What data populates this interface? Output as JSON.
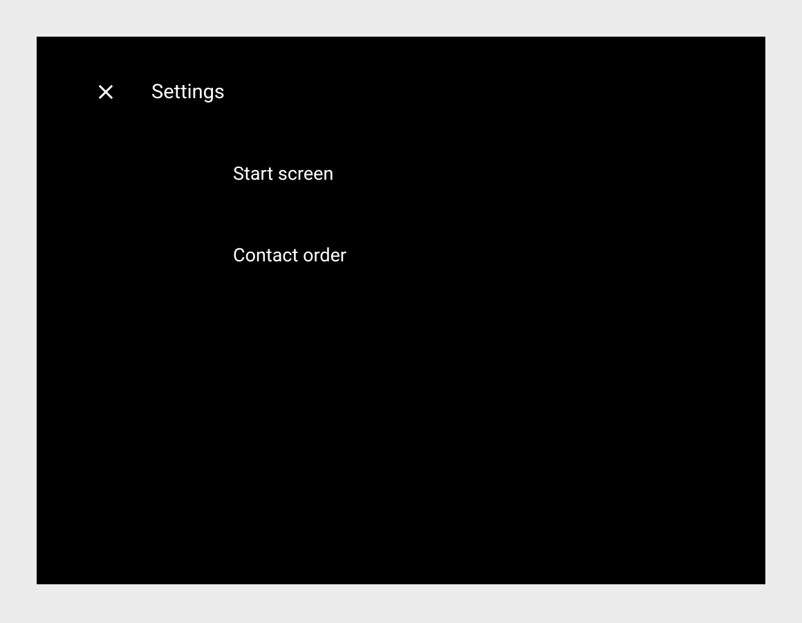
{
  "header": {
    "title": "Settings",
    "close_icon": "close-icon"
  },
  "settings": {
    "items": [
      {
        "label": "Start screen"
      },
      {
        "label": "Contact order"
      }
    ]
  }
}
